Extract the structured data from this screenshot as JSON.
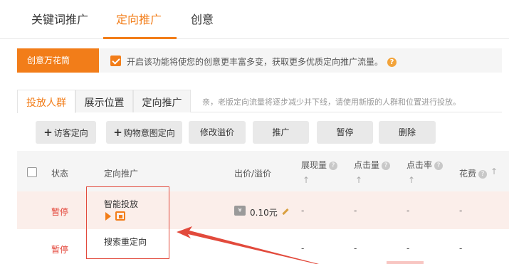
{
  "top_tabs": [
    {
      "label": "关键词推广"
    },
    {
      "label": "定向推广"
    },
    {
      "label": "创意"
    }
  ],
  "creative": {
    "label": "创意万花筒",
    "text": "开启该功能将使您的创意更丰富多变，获取更多优质定向推广流量。",
    "help": "?"
  },
  "sub_tabs": [
    {
      "label": "投放人群"
    },
    {
      "label": "展示位置"
    },
    {
      "label": "定向推广"
    }
  ],
  "sub_hint": "亲，老版定向流量将逐步减少并下线，请使用新版的人群和位置进行投放。",
  "toolbar": {
    "b1": "访客定向",
    "b2": "购物意图定向",
    "b3": "修改溢价",
    "b4": "推广",
    "b5": "暂停",
    "b6": "删除",
    "plus": "+"
  },
  "table": {
    "headers": {
      "status": "状态",
      "target": "定向推广",
      "bid": "出价/溢价",
      "impressions": "展现量",
      "clicks": "点击量",
      "ctr": "点击率",
      "cost": "花费"
    },
    "sort_arrow": "↑",
    "q": "?",
    "rows": [
      {
        "status": "暂停",
        "target": "智能投放",
        "bid": "0.10元",
        "imp": "-",
        "clk": "-",
        "ctr": "-",
        "cost": "-"
      },
      {
        "status": "暂停",
        "target": "搜索重定向",
        "imp": "-",
        "clk": "-",
        "ctr": "-",
        "cost": "-"
      }
    ]
  },
  "colors": {
    "accent": "#f27d19",
    "pause": "#e23b2e",
    "highlight": "#e24a3c"
  }
}
